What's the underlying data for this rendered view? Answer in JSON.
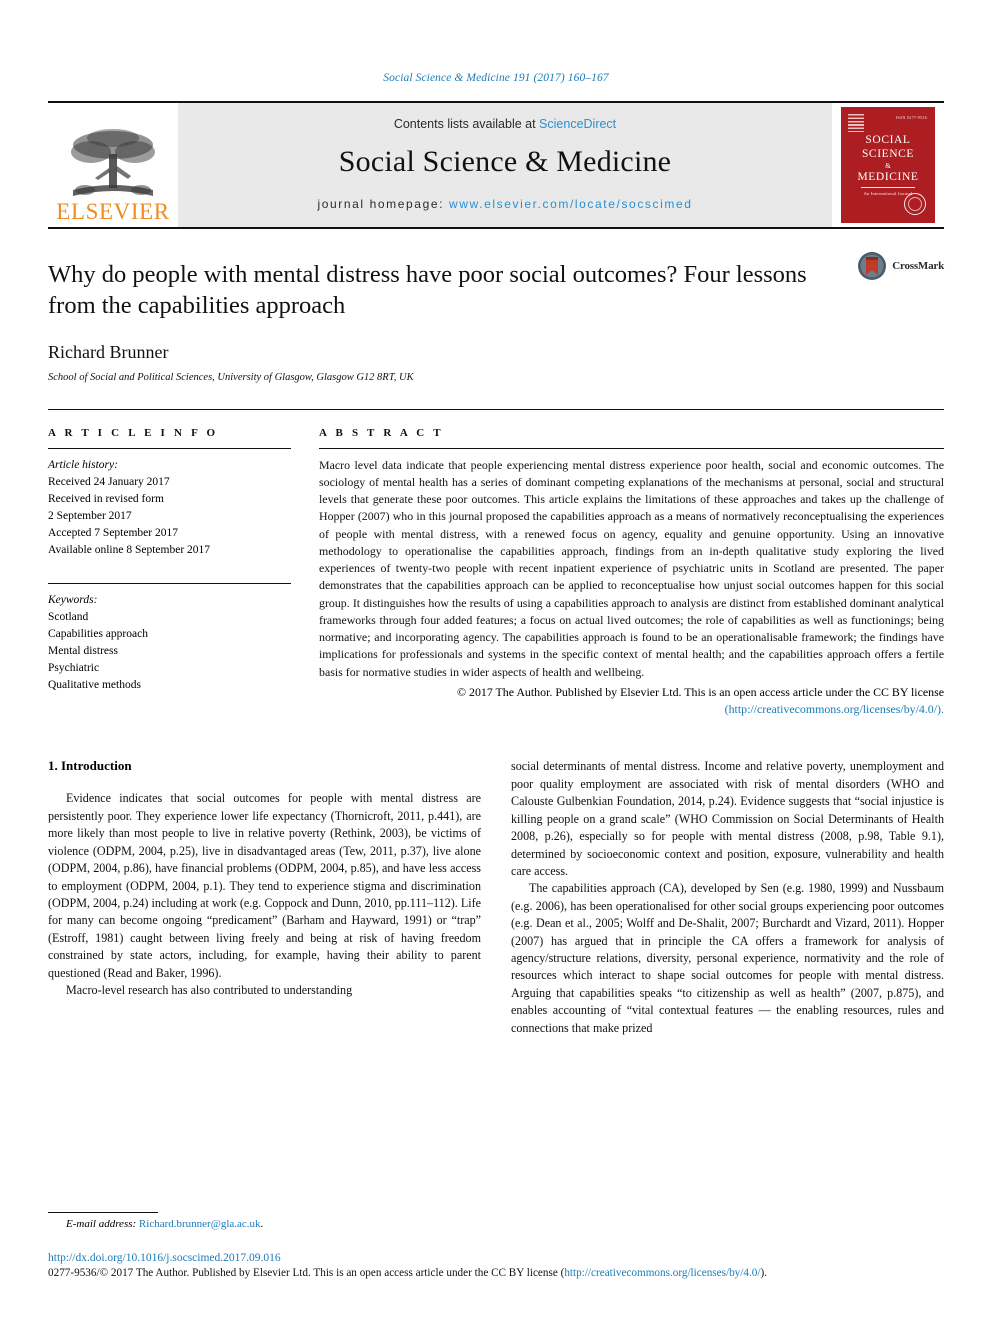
{
  "running_head": "Social Science & Medicine 191 (2017) 160–167",
  "masthead": {
    "publisher_name": "ELSEVIER",
    "contents_prefix": "Contents lists available at ",
    "contents_link": "ScienceDirect",
    "journal_name": "Social Science & Medicine",
    "homepage_prefix": "journal homepage: ",
    "homepage_url": "www.elsevier.com/locate/socscimed",
    "cover": {
      "line1": "SOCIAL",
      "line2": "SCIENCE",
      "amp": "&",
      "line3": "MEDICINE",
      "subtitle": "An International Journal",
      "corner_note": "ISSN 0277-9536"
    }
  },
  "article": {
    "title": "Why do people with mental distress have poor social outcomes? Four lessons from the capabilities approach",
    "authors": "Richard Brunner",
    "affiliation": "School of Social and Political Sciences, University of Glasgow, Glasgow G12 8RT, UK",
    "crossmark_label": "CrossMark"
  },
  "info": {
    "heading": "A R T I C L E   I N F O",
    "history_label": "Article history:",
    "history": [
      "Received 24 January 2017",
      "Received in revised form",
      "2 September 2017",
      "Accepted 7 September 2017",
      "Available online 8 September 2017"
    ],
    "keywords_label": "Keywords:",
    "keywords": [
      "Scotland",
      "Capabilities approach",
      "Mental distress",
      "Psychiatric",
      "Qualitative methods"
    ]
  },
  "abstract": {
    "heading": "A B S T R A C T",
    "text": "Macro level data indicate that people experiencing mental distress experience poor health, social and economic outcomes. The sociology of mental health has a series of dominant competing explanations of the mechanisms at personal, social and structural levels that generate these poor outcomes. This article explains the limitations of these approaches and takes up the challenge of Hopper (2007) who in this journal proposed the capabilities approach as a means of normatively reconceptualising the experiences of people with mental distress, with a renewed focus on agency, equality and genuine opportunity. Using an innovative methodology to operationalise the capabilities approach, findings from an in-depth qualitative study exploring the lived experiences of twenty-two people with recent inpatient experience of psychiatric units in Scotland are presented. The paper demonstrates that the capabilities approach can be applied to reconceptualise how unjust social outcomes happen for this social group. It distinguishes how the results of using a capabilities approach to analysis are distinct from established dominant analytical frameworks through four added features; a focus on actual lived outcomes; the role of capabilities as well as functionings; being normative; and incorporating agency. The capabilities approach is found to be an operationalisable framework; the findings have implications for professionals and systems in the specific context of mental health; and the capabilities approach offers a fertile basis for normative studies in wider aspects of health and wellbeing.",
    "copyright": "© 2017 The Author. Published by Elsevier Ltd. This is an open access article under the CC BY license",
    "license_url": "(http://creativecommons.org/licenses/by/4.0/)."
  },
  "body": {
    "section_number_title": "1. Introduction",
    "left_column": [
      "Evidence indicates that social outcomes for people with mental distress are persistently poor. They experience lower life expectancy (Thornicroft, 2011, p.441), are more likely than most people to live in relative poverty (Rethink, 2003), be victims of violence (ODPM, 2004, p.25), live in disadvantaged areas (Tew, 2011, p.37), live alone (ODPM, 2004, p.86), have financial problems (ODPM, 2004, p.85), and have less access to employment (ODPM, 2004, p.1). They tend to experience stigma and discrimination (ODPM, 2004, p.24) including at work (e.g. Coppock and Dunn, 2010, pp.111–112). Life for many can become ongoing “predicament” (Barham and Hayward, 1991) or “trap” (Estroff, 1981) caught between living freely and being at risk of having freedom constrained by state actors, including, for example, having their ability to parent questioned (Read and Baker, 1996).",
      "Macro-level research has also contributed to understanding"
    ],
    "right_column": [
      "social determinants of mental distress. Income and relative poverty, unemployment and poor quality employment are associated with risk of mental disorders (WHO and Calouste Gulbenkian Foundation, 2014, p.24). Evidence suggests that “social injustice is killing people on a grand scale” (WHO Commission on Social Determinants of Health 2008, p.26), especially so for people with mental distress (2008, p.98, Table 9.1), determined by socioeconomic context and position, exposure, vulnerability and health care access.",
      "The capabilities approach (CA), developed by Sen (e.g. 1980, 1999) and Nussbaum (e.g. 2006), has been operationalised for other social groups experiencing poor outcomes (e.g. Dean et al., 2005; Wolff and De-Shalit, 2007; Burchardt and Vizard, 2011). Hopper (2007) has argued that in principle the CA offers a framework for analysis of agency/structure relations, diversity, personal experience, normativity and the role of resources which interact to shape social outcomes for people with mental distress. Arguing that capabilities speaks “to citizenship as well as health” (2007, p.875), and enables accounting of “vital contextual features — the enabling resources, rules and connections that make prized"
    ]
  },
  "footer": {
    "email_label": "E-mail address:",
    "email": "Richard.brunner@gla.ac.uk",
    "email_suffix": ".",
    "doi": "http://dx.doi.org/10.1016/j.socscimed.2017.09.016",
    "issn_prefix": "0277-9536/",
    "issn_text": "© 2017 The Author. Published by Elsevier Ltd. This is an open access article under the CC BY license (",
    "issn_link": "http://creativecommons.org/licenses/by/4.0/",
    "issn_suffix": ")."
  },
  "colors": {
    "link_blue": "#1a7cb8",
    "sciencedirect_blue": "#2a8fd0",
    "elsevier_orange": "#f08c22",
    "cover_red": "#ad1e23",
    "masthead_gray": "#e9e9e9"
  }
}
